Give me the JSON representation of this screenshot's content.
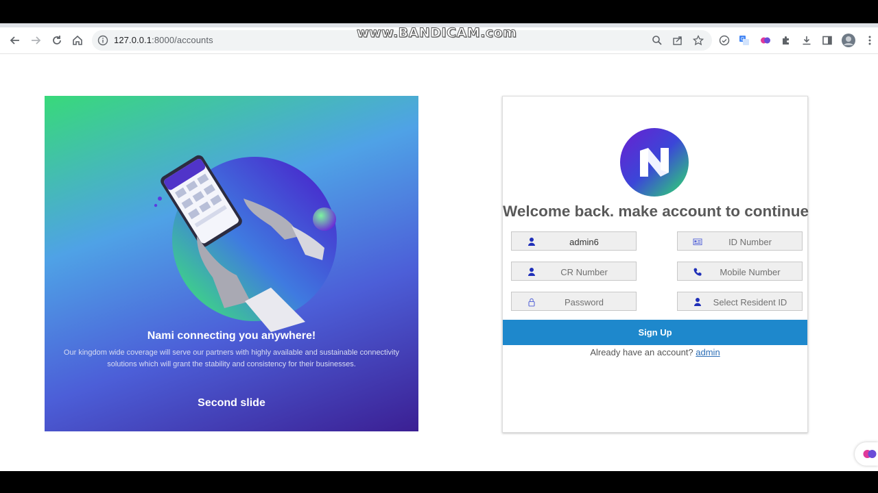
{
  "watermark": "www.BANDICAM.com",
  "browser": {
    "url_host": "127.0.0.1",
    "url_path": ":8000/accounts"
  },
  "carousel": {
    "heading": "Nami connecting you anywhere!",
    "text": "Our kingdom wide coverage will serve our partners with highly available and sustainable connectivity solutions which will grant the stability and consistency for their businesses.",
    "caption": "Second slide"
  },
  "signup": {
    "welcome": "Welcome back. make account to continue",
    "fields": {
      "username": {
        "value": "admin6",
        "icon": "user-icon"
      },
      "id_number": {
        "placeholder": "ID Number",
        "icon": "id-card-icon"
      },
      "cr_number": {
        "placeholder": "CR Number",
        "icon": "user-icon"
      },
      "mobile_number": {
        "placeholder": "Mobile Number",
        "icon": "phone-icon"
      },
      "password": {
        "placeholder": "Password",
        "icon": "lock-icon"
      },
      "resident_id": {
        "placeholder": "Select Resident ID",
        "icon": "user-icon"
      }
    },
    "button": "Sign Up",
    "already_text": "Already have an account?",
    "login_link": "admin"
  },
  "colors": {
    "accent": "#1e88cc",
    "icon": "#1f2fb8"
  }
}
